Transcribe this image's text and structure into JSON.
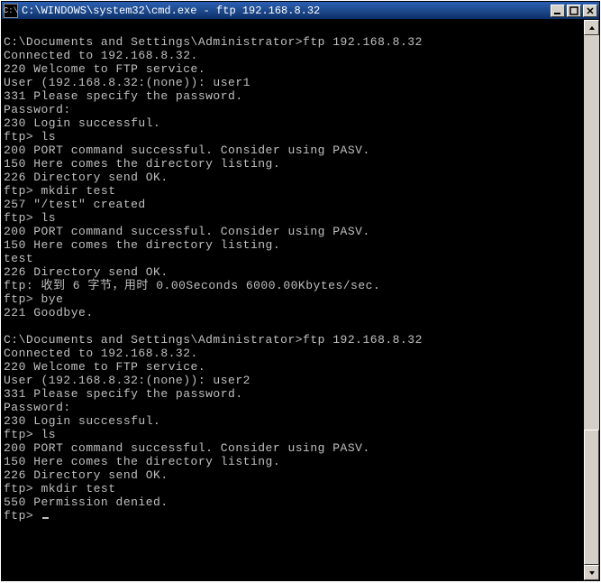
{
  "window": {
    "icon_text": "C:\\",
    "title": "C:\\WINDOWS\\system32\\cmd.exe - ftp  192.168.8.32"
  },
  "terminal_lines": [
    "",
    "C:\\Documents and Settings\\Administrator>ftp 192.168.8.32",
    "Connected to 192.168.8.32.",
    "220 Welcome to FTP service.",
    "User (192.168.8.32:(none)): user1",
    "331 Please specify the password.",
    "Password:",
    "230 Login successful.",
    "ftp> ls",
    "200 PORT command successful. Consider using PASV.",
    "150 Here comes the directory listing.",
    "226 Directory send OK.",
    "ftp> mkdir test",
    "257 \"/test\" created",
    "ftp> ls",
    "200 PORT command successful. Consider using PASV.",
    "150 Here comes the directory listing.",
    "test",
    "226 Directory send OK.",
    "ftp: 收到 6 字节，用时 0.00Seconds 6000.00Kbytes/sec.",
    "ftp> bye",
    "221 Goodbye.",
    "",
    "C:\\Documents and Settings\\Administrator>ftp 192.168.8.32",
    "Connected to 192.168.8.32.",
    "220 Welcome to FTP service.",
    "User (192.168.8.32:(none)): user2",
    "331 Please specify the password.",
    "Password:",
    "230 Login successful.",
    "ftp> ls",
    "200 PORT command successful. Consider using PASV.",
    "150 Here comes the directory listing.",
    "226 Directory send OK.",
    "ftp> mkdir test",
    "550 Permission denied.",
    "ftp>"
  ],
  "colors": {
    "terminal_bg": "#000000",
    "terminal_fg": "#c0c0c0",
    "titlebar_gradient_start": "#2a5fb5",
    "titlebar_gradient_end": "#0a2f6a",
    "button_face": "#d4d0c8"
  }
}
